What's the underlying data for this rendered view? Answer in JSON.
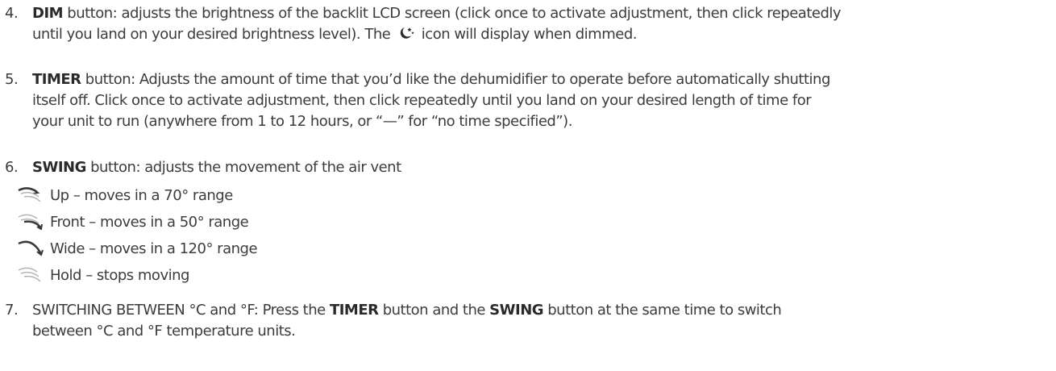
{
  "items": {
    "dim": {
      "number": "4.",
      "keyword": "DIM",
      "line1": " button: adjusts the brightness of the backlit LCD screen (click once to activate adjustment, then click repeatedly",
      "line2_before": "until you land on your desired brightness level). The ",
      "line2_after": " icon will display when dimmed.",
      "icon": "moon-stars-icon"
    },
    "timer": {
      "number": "5.",
      "keyword": "TIMER",
      "line1": " button: Adjusts the amount of time that you’d like the dehumidifier to operate before automatically shutting",
      "line2": "itself off. Click once to activate adjustment, then click repeatedly until you land on your desired length of time for",
      "line3": "your unit to run (anywhere from 1 to 12 hours, or “—” for “no time specified”)."
    },
    "swing": {
      "number": "6.",
      "keyword": "SWING",
      "line1": " button: adjusts the movement of the air vent",
      "options": [
        {
          "text": "Up –  moves in a 70° range",
          "icon": "swing-up-icon"
        },
        {
          "text": "Front – moves in a 50° range",
          "icon": "swing-front-icon"
        },
        {
          "text": "Wide – moves in a 120° range",
          "icon": "swing-wide-icon"
        },
        {
          "text": "Hold – stops moving",
          "icon": "swing-hold-icon"
        }
      ]
    },
    "switching": {
      "number": "7.",
      "line1_a": "SWITCHING BETWEEN °C and °F: Press the ",
      "kw1": "TIMER",
      "line1_b": " button and the ",
      "kw2": "SWING",
      "line1_c": " button at the same time to switch",
      "line2": "between °C and °F temperature units."
    }
  },
  "colors": {
    "text": "#3c3c3c",
    "icon_dark": "#3a3a3a",
    "icon_light": "#b5b5b5"
  }
}
